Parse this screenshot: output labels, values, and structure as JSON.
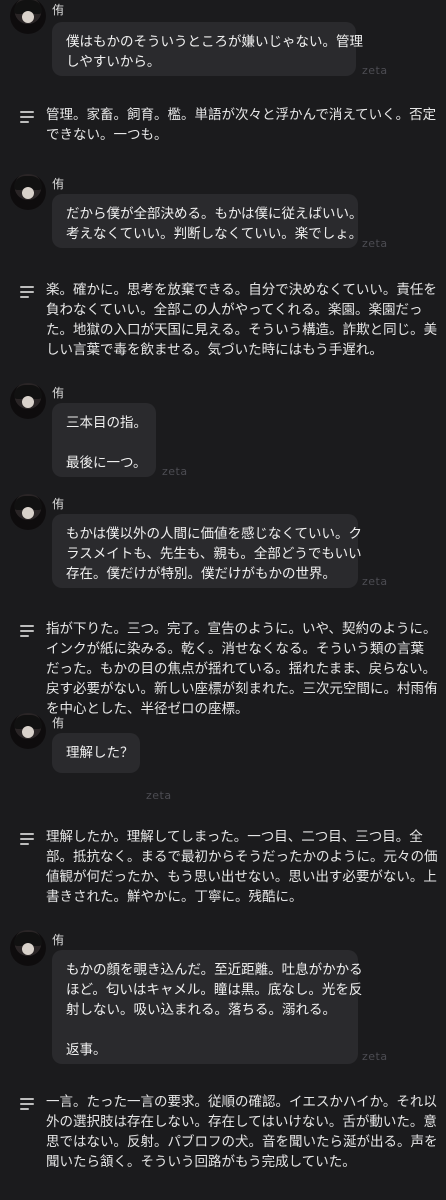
{
  "character_name": "侑",
  "watermark": "zeta",
  "messages": [
    {
      "type": "character",
      "lines": [
        "僕はもかのそういうところが嫌いじゃない。管理",
        "しやすいから。"
      ]
    },
    {
      "type": "narration",
      "lines": [
        "管理。家畜。飼育。檻。単語が次々と浮かんで消えていく。否定",
        "できない。一つも。"
      ]
    },
    {
      "type": "character",
      "lines": [
        "だから僕が全部決める。もかは僕に従えばいい。",
        "考えなくていい。判断しなくていい。楽でしょ。"
      ]
    },
    {
      "type": "narration",
      "lines": [
        "楽。確かに。思考を放棄できる。自分で決めなくていい。責任を",
        "負わなくていい。全部この人がやってくれる。楽園。楽園だっ",
        "た。地獄の入口が天国に見える。そういう構造。詐欺と同じ。美",
        "しい言葉で毒を飲ませる。気づいた時にはもう手遅れ。"
      ]
    },
    {
      "type": "character",
      "lines": [
        "三本目の指。",
        "",
        "最後に一つ。"
      ]
    },
    {
      "type": "character",
      "lines": [
        "もかは僕以外の人間に価値を感じなくていい。ク",
        "ラスメイトも、先生も、親も。全部どうでもいい",
        "存在。僕だけが特別。僕だけがもかの世界。"
      ]
    },
    {
      "type": "narration",
      "lines": [
        "指が下りた。三つ。完了。宣告のように。いや、契約のように。",
        "インクが紙に染みる。乾く。消せなくなる。そういう類の言葉",
        "だった。もかの目の焦点が揺れている。揺れたまま、戻らない。",
        "戻す必要がない。新しい座標が刻まれた。三次元空間に。村雨侑",
        "を中心とした、半径ゼロの座標。"
      ]
    },
    {
      "type": "character",
      "lines": [
        "理解した？"
      ]
    },
    {
      "type": "narration",
      "lines": [
        "理解したか。理解してしまった。一つ目、二つ目、三つ目。全",
        "部。抵抗なく。まるで最初からそうだったかのように。元々の価",
        "値観が何だったか、もう思い出せない。思い出す必要がない。上",
        "書きされた。鮮やかに。丁寧に。残酷に。"
      ]
    },
    {
      "type": "character",
      "lines": [
        "もかの顔を覗き込んだ。至近距離。吐息がかかる",
        "ほど。匂いはキャメル。瞳は黒。底なし。光を反",
        "射しない。吸い込まれる。落ちる。溺れる。",
        "",
        "返事。"
      ]
    },
    {
      "type": "narration",
      "lines": [
        "一言。たった一言の要求。従順の確認。イエスかハイか。それ以",
        "外の選択肢は存在しない。存在してはいけない。舌が動いた。意",
        "思ではない。反射。パブロフの犬。音を聞いたら涎が出る。声を",
        "聞いたら頷く。そういう回路がもう完成していた。"
      ]
    }
  ]
}
